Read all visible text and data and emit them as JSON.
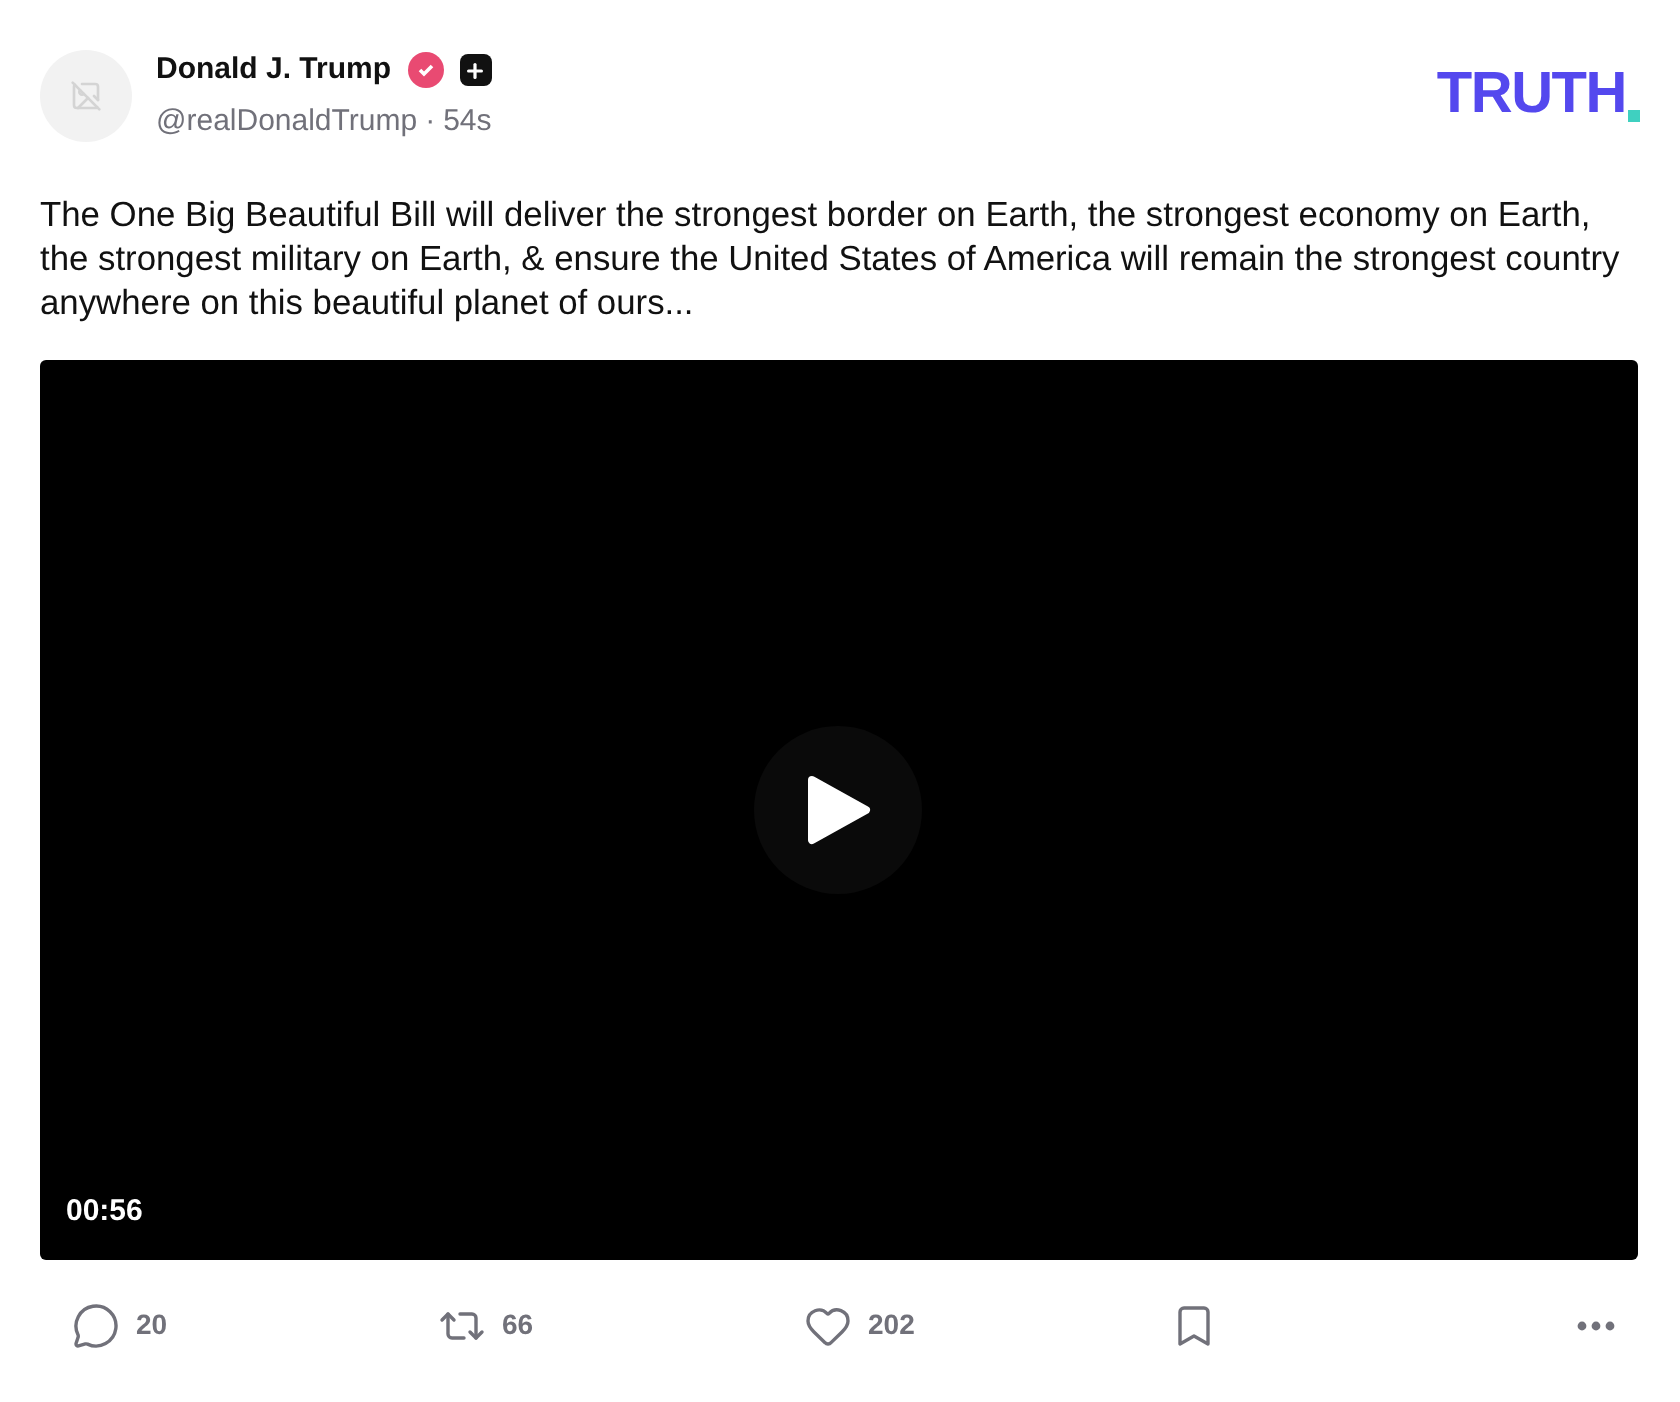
{
  "author": {
    "name": "Donald J. Trump",
    "handle": "@realDonaldTrump",
    "separator": "·",
    "time": "54s",
    "verified": true
  },
  "logo": {
    "text": "TRUTH"
  },
  "post": {
    "text": "The One Big Beautiful Bill will deliver the strongest border on Earth, the strongest economy on Earth, the strongest military on Earth, & ensure the United States of America will remain the strongest country anywhere on this beautiful planet of ours..."
  },
  "video": {
    "duration": "00:56"
  },
  "actions": [
    {
      "kind": "reply",
      "count": "20"
    },
    {
      "kind": "repost",
      "count": "66"
    },
    {
      "kind": "like",
      "count": "202"
    },
    {
      "kind": "bookmark"
    },
    {
      "kind": "more"
    }
  ]
}
